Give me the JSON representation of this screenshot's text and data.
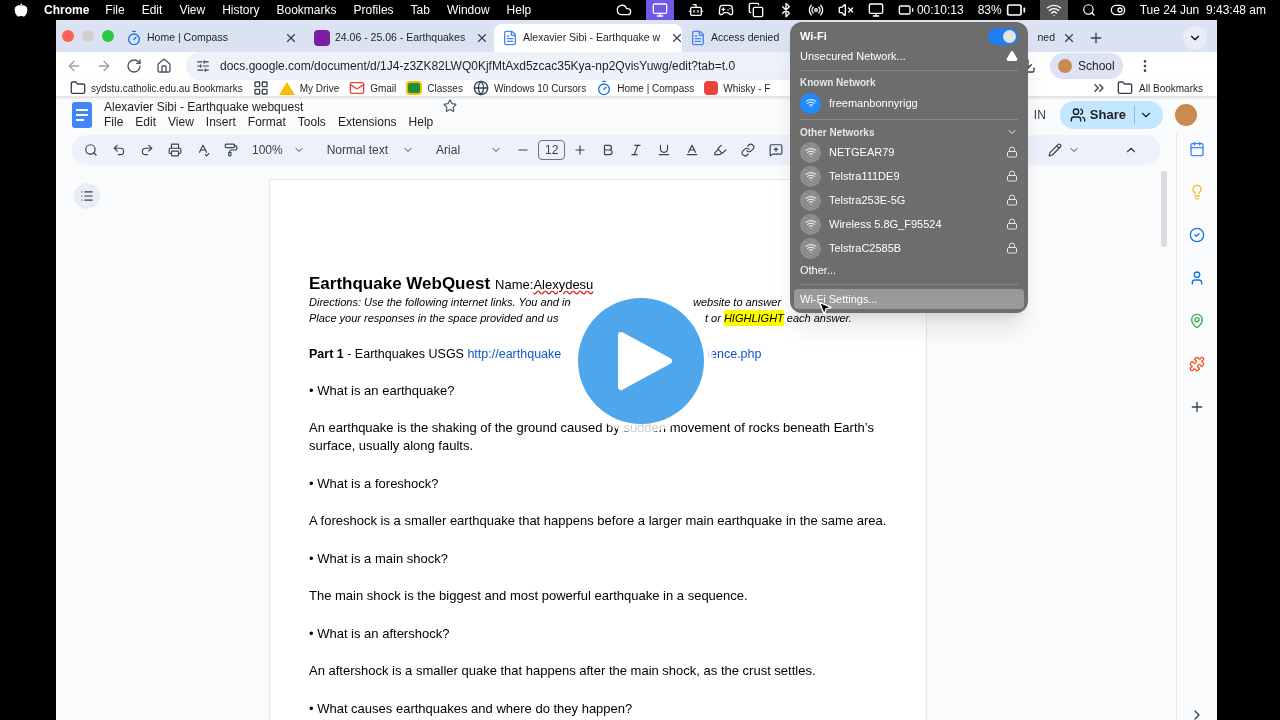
{
  "menubar": {
    "app": "Chrome",
    "menus": [
      "File",
      "Edit",
      "View",
      "History",
      "Bookmarks",
      "Profiles",
      "Tab",
      "Window",
      "Help"
    ],
    "timer": "00:10:13",
    "battery": "83%",
    "datetime": "Tue 24 Jun  9:43:48 am"
  },
  "tabs": [
    {
      "title": "Home | Compass",
      "selected": false,
      "kind": "compass"
    },
    {
      "title": "24.06 - 25.06 - Earthquakes",
      "selected": false,
      "kind": "classroom"
    },
    {
      "title": "Alexavier Sibi - Earthquake w",
      "selected": true,
      "kind": "docs"
    },
    {
      "title": "Access denied",
      "selected": false,
      "kind": "docs"
    },
    {
      "title": "ned",
      "selected": false,
      "kind": "none"
    }
  ],
  "address": "docs.google.com/document/d/1J4-z3ZK82LWQ0KjfMtAxd5zcac35Kya-np2QvisYuwg/edit?tab=t.0",
  "profile": "School",
  "bookmarks": [
    {
      "label": "sydstu.catholic.edu.au Bookmarks",
      "kind": "folder"
    },
    {
      "label": "My Drive",
      "kind": "drive"
    },
    {
      "label": "Gmail",
      "kind": "gmail"
    },
    {
      "label": "Classes",
      "kind": "classroom"
    },
    {
      "label": "Windows 10 Cursors",
      "kind": "globe"
    },
    {
      "label": "Home | Compass",
      "kind": "compass"
    },
    {
      "label": "Whisky - F",
      "kind": "red"
    }
  ],
  "all_bookmarks": "All Bookmarks",
  "doc": {
    "title": "Alexavier Sibi - Earthquake webquest",
    "menus": [
      "File",
      "Edit",
      "View",
      "Insert",
      "Format",
      "Tools",
      "Extensions",
      "Help"
    ],
    "zoom": "100%",
    "style": "Normal text",
    "font": "Arial",
    "size": "12",
    "partial_label": "IN",
    "share": "Share"
  },
  "content": [
    {
      "kind": "heading",
      "title": "Earthquake WebQuest",
      "label": "Name:",
      "value": "Alexydesu"
    },
    {
      "kind": "directions",
      "left": "Directions: Use the following internet links. You and in",
      "right": "website to answer"
    },
    {
      "kind": "directions",
      "left": "Place your responses in the space provided and us",
      "right": "t or ",
      "highlight": "HIGHLIGHT",
      "after": " each answer."
    },
    {
      "kind": "part",
      "label": "Part 1",
      "text": " - Earthquakes USGS ",
      "link": "http://earthquake",
      "link_rest": "ience.php"
    },
    {
      "kind": "question",
      "text": "• What is an earthquake?"
    },
    {
      "kind": "answer",
      "text": "An earthquake is the shaking of the ground caused by sudden movement of rocks beneath Earth’s surface, usually along faults."
    },
    {
      "kind": "question",
      "text": "• What is a foreshock?"
    },
    {
      "kind": "answer",
      "text": "A foreshock is a smaller earthquake that happens before a larger main earthquake in the same area."
    },
    {
      "kind": "question",
      "text": "• What is a main shock?"
    },
    {
      "kind": "answer",
      "text": "The main shock is the biggest and most powerful earthquake in a sequence."
    },
    {
      "kind": "question",
      "text": "• What is an aftershock?"
    },
    {
      "kind": "answer",
      "text": "An aftershock is a smaller quake that happens after the main shock, as the crust settles."
    },
    {
      "kind": "question",
      "text": "• What causes earthquakes and where do they happen?"
    }
  ],
  "wifi": {
    "title": "Wi-Fi",
    "on": true,
    "unsecured": "Unsecured Network...",
    "known_heading": "Known Network",
    "known": [
      {
        "name": "freemanbonnyrigg",
        "connected": true
      }
    ],
    "other_heading": "Other Networks",
    "networks": [
      {
        "name": "NETGEAR79",
        "connected": false,
        "locked": true
      },
      {
        "name": "Telstra111DE9",
        "connected": false,
        "locked": true
      },
      {
        "name": "Telstra253E-5G",
        "connected": false,
        "locked": true
      },
      {
        "name": "Wireless 5.8G_F95524",
        "connected": false,
        "locked": true
      },
      {
        "name": "TelstraC2585B",
        "connected": false,
        "locked": true
      }
    ],
    "other": "Other...",
    "settings": {
      "label": "Wi-Fi Settings...",
      "selected": true
    }
  }
}
